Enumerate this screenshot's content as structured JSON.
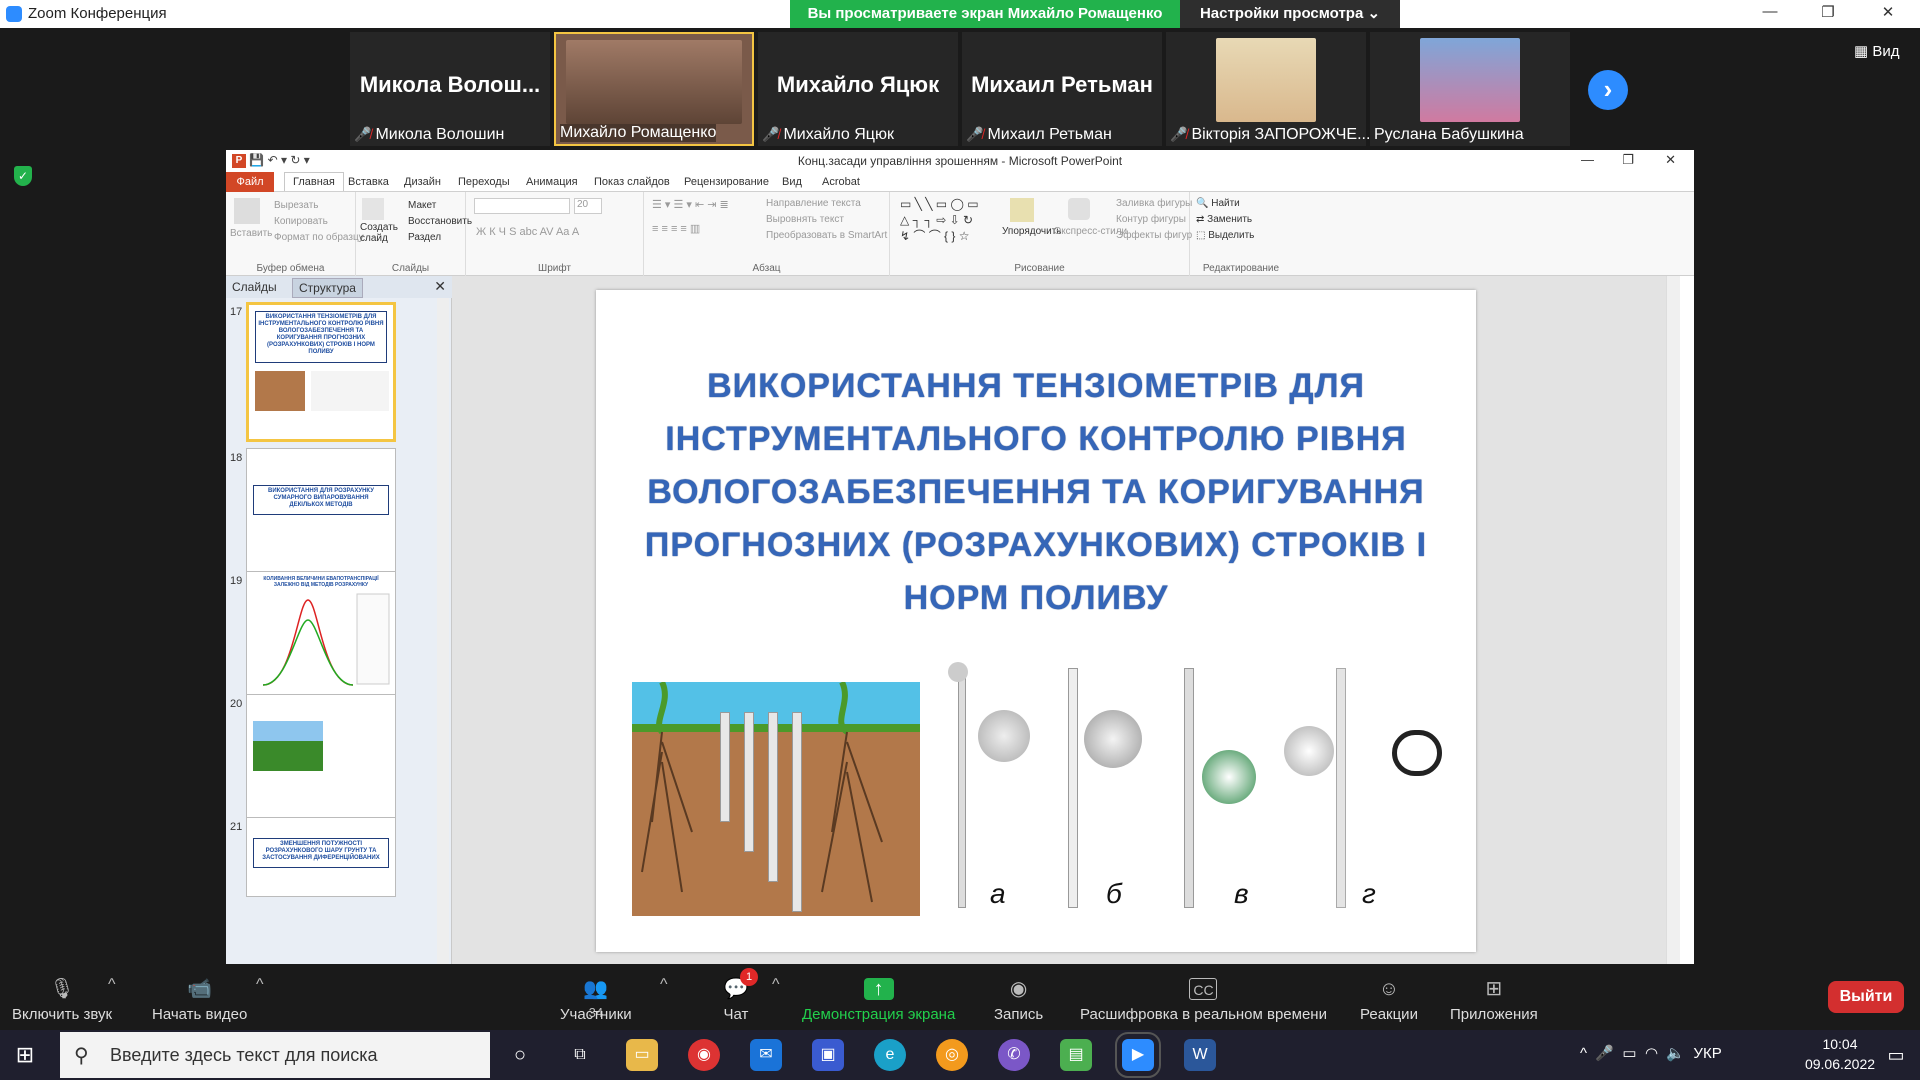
{
  "zoom": {
    "window_title": "Zoom Конференция",
    "share_banner": "Вы просматриваете экран Михайло Ромащенко",
    "view_settings": "Настройки просмотра ⌄",
    "view_label": "Вид",
    "participants": [
      {
        "big_name": "Микола  Волош...",
        "label": "Микола Волошин",
        "muted": true
      },
      {
        "big_name": "",
        "label": "Михайло Ромащенко",
        "muted": false
      },
      {
        "big_name": "Михайло Яцюк",
        "label": "Михайло Яцюк",
        "muted": true
      },
      {
        "big_name": "Михаил Ретьман",
        "label": "Михаил Ретьман",
        "muted": true
      },
      {
        "big_name": "",
        "label": "Вікторія ЗАПОРОЖЧЕ...",
        "muted": true
      },
      {
        "big_name": "",
        "label": "Руслана Бабушкина",
        "muted": false
      }
    ],
    "toolbar": {
      "unmute": "Включить звук",
      "start_video": "Начать видео",
      "participants": "Участники",
      "participants_count": "34",
      "chat": "Чат",
      "chat_badge": "1",
      "share": "Демонстрация экрана",
      "record": "Запись",
      "transcript": "Расшифровка в реальном времени",
      "reactions": "Реакции",
      "apps": "Приложения",
      "leave": "Выйти"
    }
  },
  "ppt": {
    "title": "Конц.засади управління зрошенням  -  Microsoft PowerPoint",
    "tabs": [
      "Файл",
      "Главная",
      "Вставка",
      "Дизайн",
      "Переходы",
      "Анимация",
      "Показ слайдов",
      "Рецензирование",
      "Вид",
      "Acrobat"
    ],
    "ribbon": {
      "clipboard": {
        "name": "Буфер обмена",
        "paste": "Вставить",
        "cut": "Вырезать",
        "copy": "Копировать",
        "format_painter": "Формат по образцу"
      },
      "slides": {
        "name": "Слайды",
        "new_slide": "Создать слайд",
        "layout": "Макет",
        "reset": "Восстановить",
        "section": "Раздел"
      },
      "font": {
        "name": "Шрифт",
        "size": "20"
      },
      "paragraph": {
        "name": "Абзац",
        "direction": "Направление текста",
        "align": "Выровнять текст",
        "smartart": "Преобразовать в SmartArt"
      },
      "drawing": {
        "name": "Рисование",
        "arrange": "Упорядочить",
        "quick_styles": "Экспресс-стили",
        "fill": "Заливка фигуры",
        "outline": "Контур фигуры",
        "effects": "Эффекты фигур"
      },
      "editing": {
        "name": "Редактирование",
        "find": "Найти",
        "replace": "Заменить",
        "select": "Выделить"
      }
    },
    "pane": {
      "tab_slides": "Слайды",
      "tab_outline": "Структура"
    },
    "thumbs": [
      {
        "num": "17",
        "text": "ВИКОРИСТАННЯ ТЕНЗІОМЕТРІВ ДЛЯ ІНСТРУМЕНТАЛЬНОГО КОНТРОЛЮ РІВНЯ ВОЛОГОЗАБЕЗПЕЧЕННЯ ТА КОРИГУВАННЯ ПРОГНОЗНИХ (РОЗРАХУНКОВИХ) СТРОКІВ І НОРМ ПОЛИВУ"
      },
      {
        "num": "18",
        "text": "ВИКОРИСТАННЯ ДЛЯ РОЗРАХУНКУ СУМАРНОГО ВИПАРОВУВАННЯ ДЕКІЛЬКОХ МЕТОДІВ"
      },
      {
        "num": "19",
        "text": "КОЛИВАННЯ ВЕЛИЧИНИ ЕВАПОТРАНСПІРАЦІЇ ЗАЛЕЖНО ВІД МЕТОДІВ РОЗРАХУНКУ"
      },
      {
        "num": "20",
        "text": ""
      },
      {
        "num": "21",
        "text": "ЗМЕНШЕННЯ ПОТУЖНОСТІ РОЗРАХУНКОВОГО ШАРУ ГРУНТУ ТА ЗАСТОСУВАННЯ ДИФЕРЕНЦІЙОВАНИХ"
      }
    ],
    "slide": {
      "title": "ВИКОРИСТАННЯ ТЕНЗІОМЕТРІВ ДЛЯ ІНСТРУМЕНТАЛЬНОГО КОНТРОЛЮ РІВНЯ ВОЛОГОЗАБЕЗПЕЧЕННЯ ТА КОРИГУВАННЯ ПРОГНОЗНИХ (РОЗРАХУНКОВИХ) СТРОКІВ І НОРМ ПОЛИВУ",
      "letters": [
        "а",
        "б",
        "в",
        "г"
      ]
    }
  },
  "taskbar": {
    "search_placeholder": "Введите здесь текст для поиска",
    "lang": "УКР",
    "time": "10:04",
    "date": "09.06.2022"
  },
  "colors": {
    "zoom_green": "#22b24c",
    "zoom_blue": "#2d8cff",
    "ppt_orange": "#d24726",
    "slide_title": "#3566b8",
    "leave_red": "#d32f2f"
  }
}
